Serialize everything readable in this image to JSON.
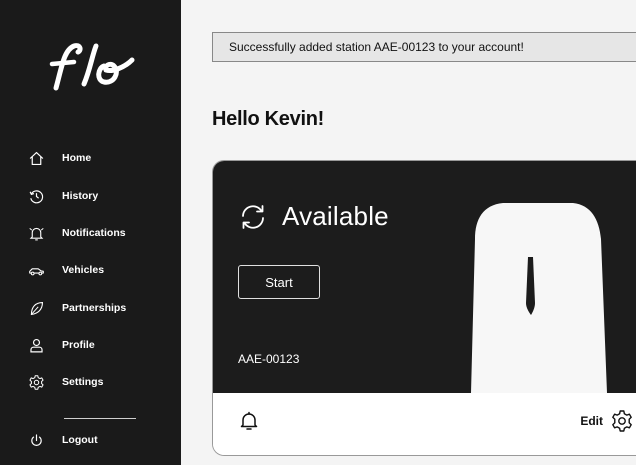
{
  "app": {
    "logo_text": "flo"
  },
  "sidebar": {
    "items": [
      {
        "label": "Home",
        "icon": "home-icon"
      },
      {
        "label": "History",
        "icon": "history-icon"
      },
      {
        "label": "Notifications",
        "icon": "bell-icon"
      },
      {
        "label": "Vehicles",
        "icon": "car-icon"
      },
      {
        "label": "Partnerships",
        "icon": "leaf-icon"
      },
      {
        "label": "Profile",
        "icon": "user-icon"
      },
      {
        "label": "Settings",
        "icon": "gear-icon"
      }
    ],
    "logout": {
      "label": "Logout",
      "icon": "power-icon"
    }
  },
  "notice": {
    "text": "Successfully added station AAE-00123 to your account!"
  },
  "greeting": "Hello Kevin!",
  "station": {
    "status": "Available",
    "start_label": "Start",
    "id": "AAE-00123",
    "edit_label": "Edit"
  },
  "colors": {
    "sidebar_bg": "#1a1a1a",
    "card_dark": "#1c1c1c",
    "page_bg": "#f4f4f4"
  }
}
